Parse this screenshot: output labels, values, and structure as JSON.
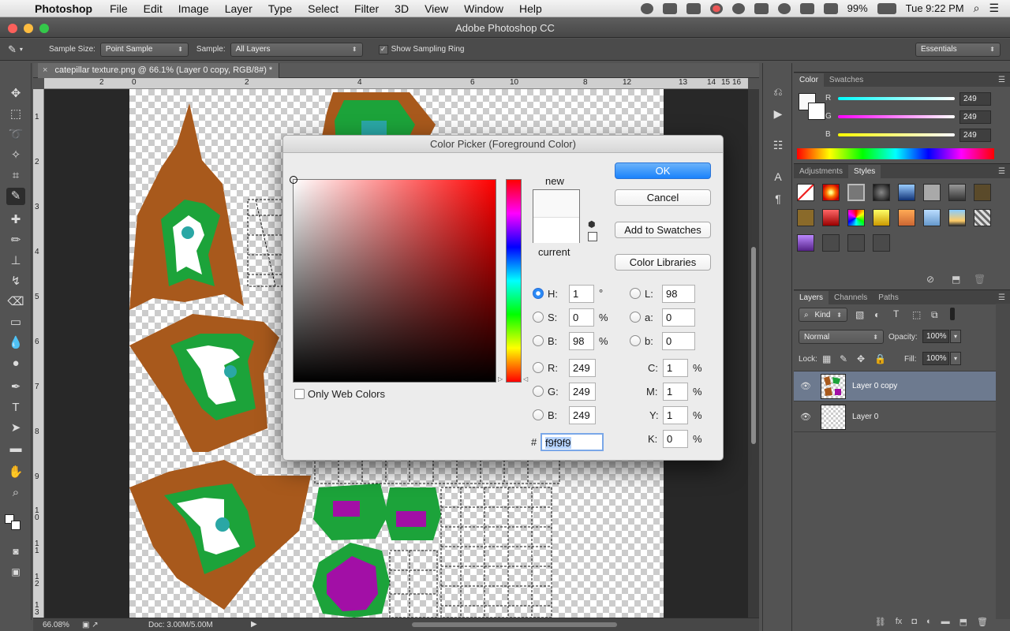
{
  "menubar": {
    "app": "Photoshop",
    "items": [
      "File",
      "Edit",
      "Image",
      "Layer",
      "Type",
      "Select",
      "Filter",
      "3D",
      "View",
      "Window",
      "Help"
    ],
    "battery": "99%",
    "clock": "Tue 9:22 PM"
  },
  "window": {
    "title": "Adobe Photoshop CC"
  },
  "options": {
    "sample_size_label": "Sample Size:",
    "sample_size_value": "Point Sample",
    "sample_label": "Sample:",
    "sample_value": "All Layers",
    "show_ring_label": "Show Sampling Ring",
    "workspace": "Essentials"
  },
  "document": {
    "tab_title": "catepillar texture.png @ 66.1% (Layer 0 copy, RGB/8#) *",
    "ruler_top": [
      "2",
      "0",
      "2",
      "4",
      "6",
      "8",
      "10",
      "12",
      "13",
      "14",
      "15",
      "16"
    ],
    "ruler_left": [
      "1",
      "2",
      "3",
      "4",
      "5",
      "6",
      "7",
      "8",
      "9",
      "1\n0",
      "1\n1",
      "1\n2",
      "1\n3"
    ]
  },
  "status": {
    "zoom": "66.08%",
    "doc": "Doc: 3.00M/5.00M"
  },
  "color_panel": {
    "tabs": [
      "Color",
      "Swatches"
    ],
    "channels": [
      {
        "label": "R",
        "value": "249"
      },
      {
        "label": "G",
        "value": "249"
      },
      {
        "label": "B",
        "value": "249"
      }
    ]
  },
  "styles_panel": {
    "tabs": [
      "Adjustments",
      "Styles"
    ]
  },
  "layers_panel": {
    "tabs": [
      "Layers",
      "Channels",
      "Paths"
    ],
    "kind": "Kind",
    "blend_mode": "Normal",
    "opacity_label": "Opacity:",
    "opacity": "100%",
    "lock_label": "Lock:",
    "fill_label": "Fill:",
    "fill": "100%",
    "layers": [
      {
        "name": "Layer 0 copy",
        "selected": true
      },
      {
        "name": "Layer 0",
        "selected": false
      }
    ]
  },
  "dialog": {
    "title": "Color Picker (Foreground Color)",
    "ok": "OK",
    "cancel": "Cancel",
    "add_swatches": "Add to Swatches",
    "color_libraries": "Color Libraries",
    "new_label": "new",
    "current_label": "current",
    "only_web": "Only Web Colors",
    "hex_label": "#",
    "hex": "f9f9f9",
    "hsb": {
      "h": "1",
      "s": "0",
      "b": "98",
      "h_unit": "°",
      "s_unit": "%",
      "b_unit": "%"
    },
    "rgb": {
      "r": "249",
      "g": "249",
      "b": "249"
    },
    "lab": {
      "l": "98",
      "a": "0",
      "b": "0"
    },
    "cmyk": {
      "c": "1",
      "m": "1",
      "y": "1",
      "k": "0",
      "unit": "%"
    },
    "labels": {
      "H": "H:",
      "S": "S:",
      "B": "B:",
      "R": "R:",
      "G": "G:",
      "Bb": "B:",
      "L": "L:",
      "a": "a:",
      "b": "b:",
      "C": "C:",
      "M": "M:",
      "Y": "Y:",
      "K": "K:"
    },
    "hue_color": "#ff0000",
    "new_color": "#f9f9f9",
    "current_color": "#ffffff"
  }
}
